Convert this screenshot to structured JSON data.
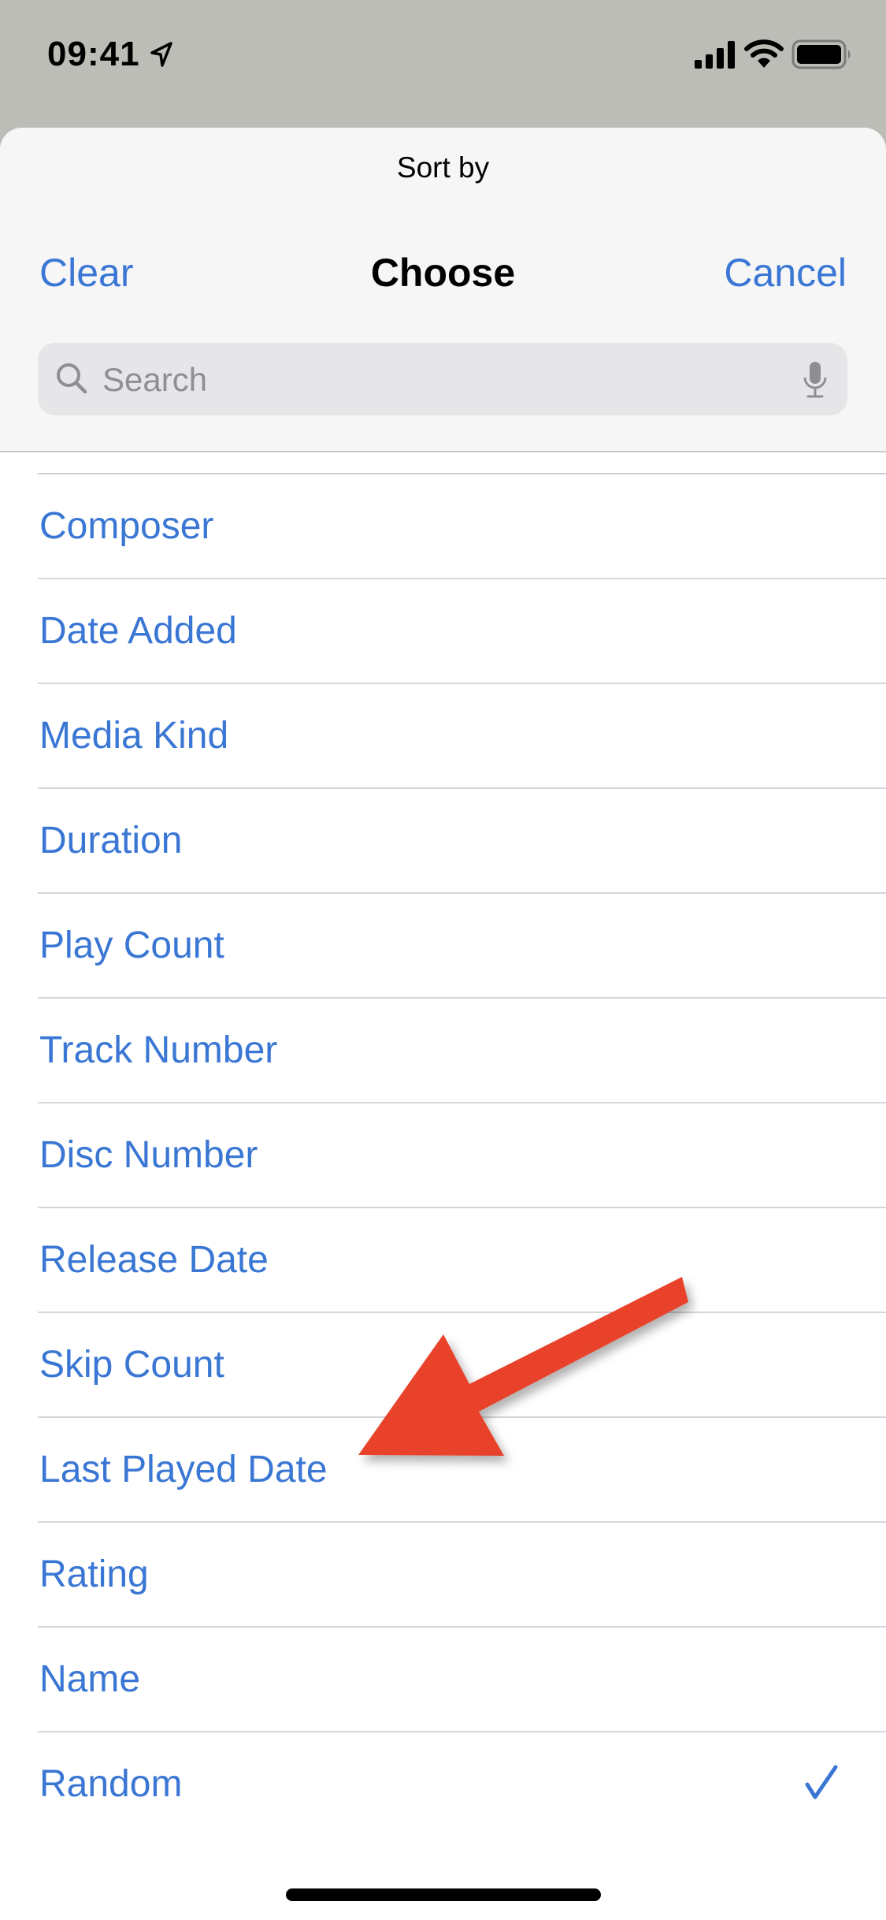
{
  "status_bar": {
    "time": "09:41",
    "icons": [
      "location-arrow-icon",
      "cellular-signal-icon",
      "wifi-icon",
      "battery-icon"
    ]
  },
  "sheet": {
    "prompt": "Sort by",
    "nav": {
      "left_label": "Clear",
      "title": "Choose",
      "right_label": "Cancel"
    },
    "search": {
      "placeholder": "Search",
      "value": "",
      "icons": [
        "search-icon",
        "microphone-icon"
      ]
    },
    "options": [
      {
        "label": "Composer",
        "selected": false
      },
      {
        "label": "Date Added",
        "selected": false
      },
      {
        "label": "Media Kind",
        "selected": false
      },
      {
        "label": "Duration",
        "selected": false
      },
      {
        "label": "Play Count",
        "selected": false
      },
      {
        "label": "Track Number",
        "selected": false
      },
      {
        "label": "Disc Number",
        "selected": false
      },
      {
        "label": "Release Date",
        "selected": false
      },
      {
        "label": "Skip Count",
        "selected": false
      },
      {
        "label": "Last Played Date",
        "selected": false
      },
      {
        "label": "Rating",
        "selected": false
      },
      {
        "label": "Name",
        "selected": false
      },
      {
        "label": "Random",
        "selected": true
      }
    ]
  },
  "annotation": {
    "type": "arrow",
    "points_to": "Last Played Date",
    "color": "#e8432a"
  },
  "colors": {
    "accent": "#3a77d4",
    "header_bg": "#f6f6f7",
    "search_bg": "#e6e6e9",
    "dimmed_backdrop": "#bdbdb8"
  }
}
